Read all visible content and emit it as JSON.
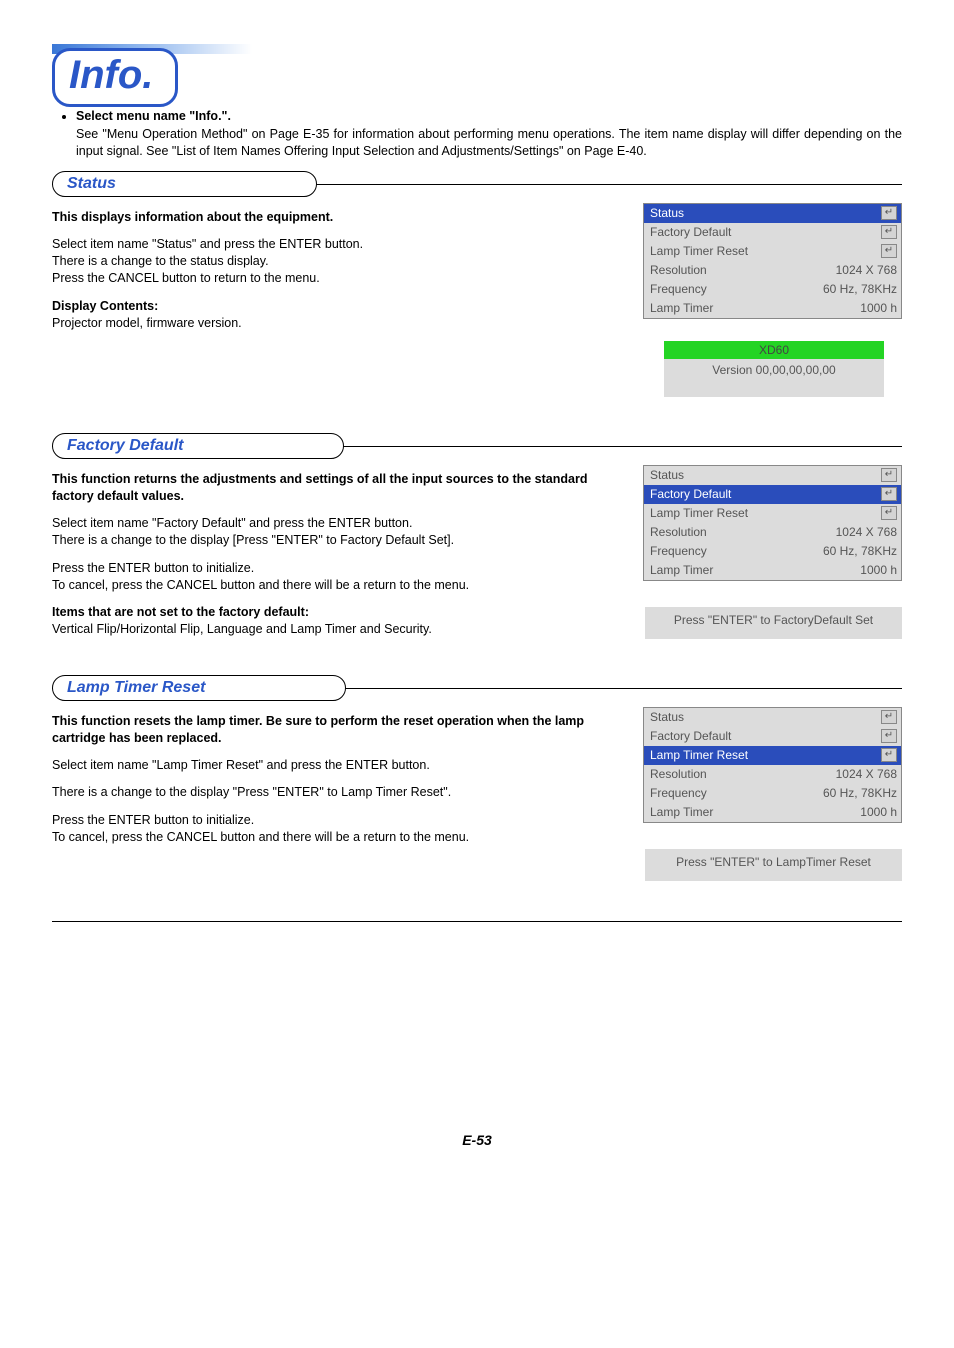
{
  "page_title": "Info.",
  "page_number": "E-53",
  "intro": {
    "bullet": "Select menu name \"Info.\".",
    "body": "See \"Menu Operation Method\" on Page E-35 for information about performing menu operations. The item name display will differ depending on the input signal. See \"List of Item Names Offering Input Selection and Adjustments/Settings\" on Page E-40."
  },
  "sections": [
    {
      "heading": "Status",
      "left": {
        "p1_bold": "This displays information about the equipment.",
        "p2": "Select item name \"Status\" and press the ENTER button.\nThere is a change to the status display.\nPress the CANCEL button to return to the menu.",
        "p3_bold": "Display Contents:",
        "p3_body": "Projector model, firmware version."
      },
      "menu": {
        "highlight_index": 0,
        "rows": [
          {
            "label": "Status",
            "value": "",
            "icon": true
          },
          {
            "label": "Factory Default",
            "value": "",
            "icon": true
          },
          {
            "label": "Lamp Timer Reset",
            "value": "",
            "icon": true
          },
          {
            "label": "Resolution",
            "value": "1024 X 768"
          },
          {
            "label": "Frequency",
            "value": "60 Hz, 78KHz"
          },
          {
            "label": "Lamp Timer",
            "value": "1000 h"
          }
        ]
      },
      "sub_panel": {
        "model": "XD60",
        "version": "Version 00,00,00,00,00"
      }
    },
    {
      "heading": "Factory Default",
      "left": {
        "p1_bold": "This function returns the adjustments and settings of all the input sources to the standard factory default values.",
        "p2": "Select item name \"Factory Default\" and press the ENTER button.\nThere is a change to the display [Press \"ENTER\" to Factory Default Set].",
        "p3": "Press the ENTER button to initialize.\nTo cancel, press the CANCEL button and there will be a return to the menu.",
        "p4_bold": "Items that are not set to the factory default:",
        "p4_body": "Vertical Flip/Horizontal Flip, Language and Lamp Timer and Security."
      },
      "menu": {
        "highlight_index": 1,
        "rows": [
          {
            "label": "Status",
            "value": "",
            "icon": true
          },
          {
            "label": "Factory Default",
            "value": "",
            "icon": true
          },
          {
            "label": "Lamp Timer Reset",
            "value": "",
            "icon": true
          },
          {
            "label": "Resolution",
            "value": "1024 X 768"
          },
          {
            "label": "Frequency",
            "value": "60 Hz, 78KHz"
          },
          {
            "label": "Lamp Timer",
            "value": "1000 h"
          }
        ]
      },
      "confirm": "Press \"ENTER\" to FactoryDefault Set"
    },
    {
      "heading": "Lamp Timer Reset",
      "left": {
        "p1_bold": "This function resets the lamp timer. Be sure to perform the reset operation when the lamp cartridge has been replaced.",
        "p2": "Select item name \"Lamp Timer Reset\" and press the ENTER button.",
        "p3": "There is a change to the display \"Press \"ENTER\" to Lamp Timer Reset\".",
        "p4": "Press the ENTER button to initialize.\nTo cancel, press the CANCEL button and there will be a return to the menu."
      },
      "menu": {
        "highlight_index": 2,
        "rows": [
          {
            "label": "Status",
            "value": "",
            "icon": true
          },
          {
            "label": "Factory Default",
            "value": "",
            "icon": true
          },
          {
            "label": "Lamp Timer Reset",
            "value": "",
            "icon": true
          },
          {
            "label": "Resolution",
            "value": "1024 X 768"
          },
          {
            "label": "Frequency",
            "value": "60 Hz, 78KHz"
          },
          {
            "label": "Lamp Timer",
            "value": "1000 h"
          }
        ]
      },
      "confirm": "Press \"ENTER\" to LampTimer Reset"
    }
  ]
}
